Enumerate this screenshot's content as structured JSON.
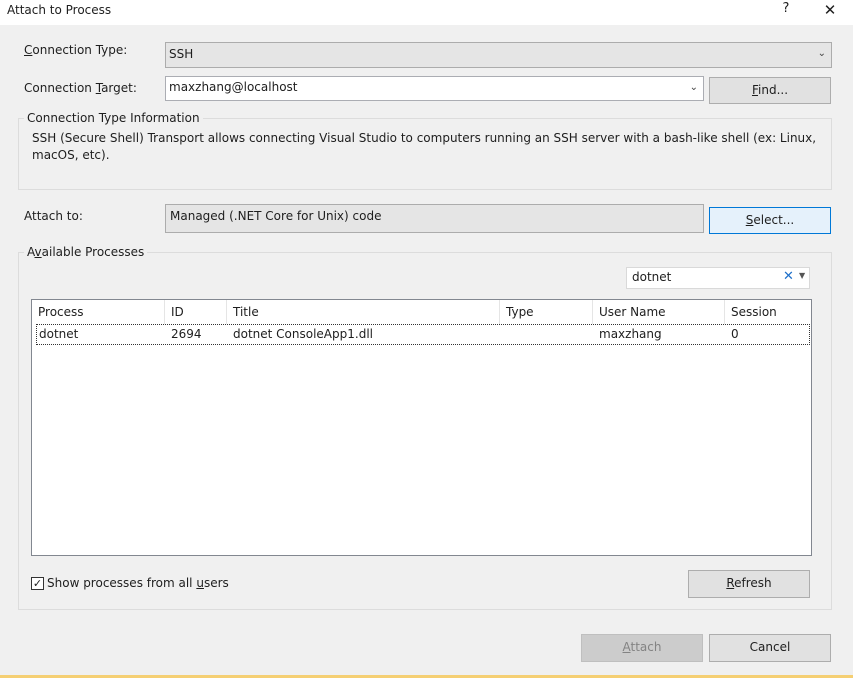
{
  "window": {
    "title": "Attach to Process",
    "help_glyph": "?",
    "close_glyph": "✕"
  },
  "connection_type": {
    "label_pre": "",
    "label_key": "C",
    "label_post": "onnection Type:",
    "value": "SSH"
  },
  "connection_target": {
    "label_pre": "Connection ",
    "label_key": "T",
    "label_post": "arget:",
    "value": "maxzhang@localhost",
    "find_pre": "",
    "find_key": "F",
    "find_post": "ind..."
  },
  "info": {
    "heading": "Connection Type Information",
    "text": "SSH (Secure Shell) Transport allows connecting Visual Studio to computers running an SSH server with a bash-like shell (ex: Linux, macOS, etc)."
  },
  "attach_to": {
    "label": "Attach to:",
    "value": "Managed (.NET Core for Unix) code",
    "select_pre": "",
    "select_key": "S",
    "select_post": "elect..."
  },
  "processes": {
    "heading_pre": "A",
    "heading_key": "v",
    "heading_post": "ailable Processes",
    "filter": "dotnet",
    "columns": [
      "Process",
      "ID",
      "Title",
      "Type",
      "User Name",
      "Session"
    ],
    "rows": [
      {
        "process": "dotnet",
        "id": "2694",
        "title": "dotnet ConsoleApp1.dll",
        "type": "",
        "user": "maxzhang",
        "session": "0"
      }
    ]
  },
  "show_all": {
    "checked": true,
    "check_glyph": "✓",
    "pre": "Show processes from all ",
    "key": "u",
    "post": "sers"
  },
  "refresh": {
    "pre": "",
    "key": "R",
    "post": "efresh"
  },
  "attach": {
    "pre": "",
    "key": "A",
    "post": "ttach"
  },
  "cancel": {
    "label": "Cancel"
  }
}
